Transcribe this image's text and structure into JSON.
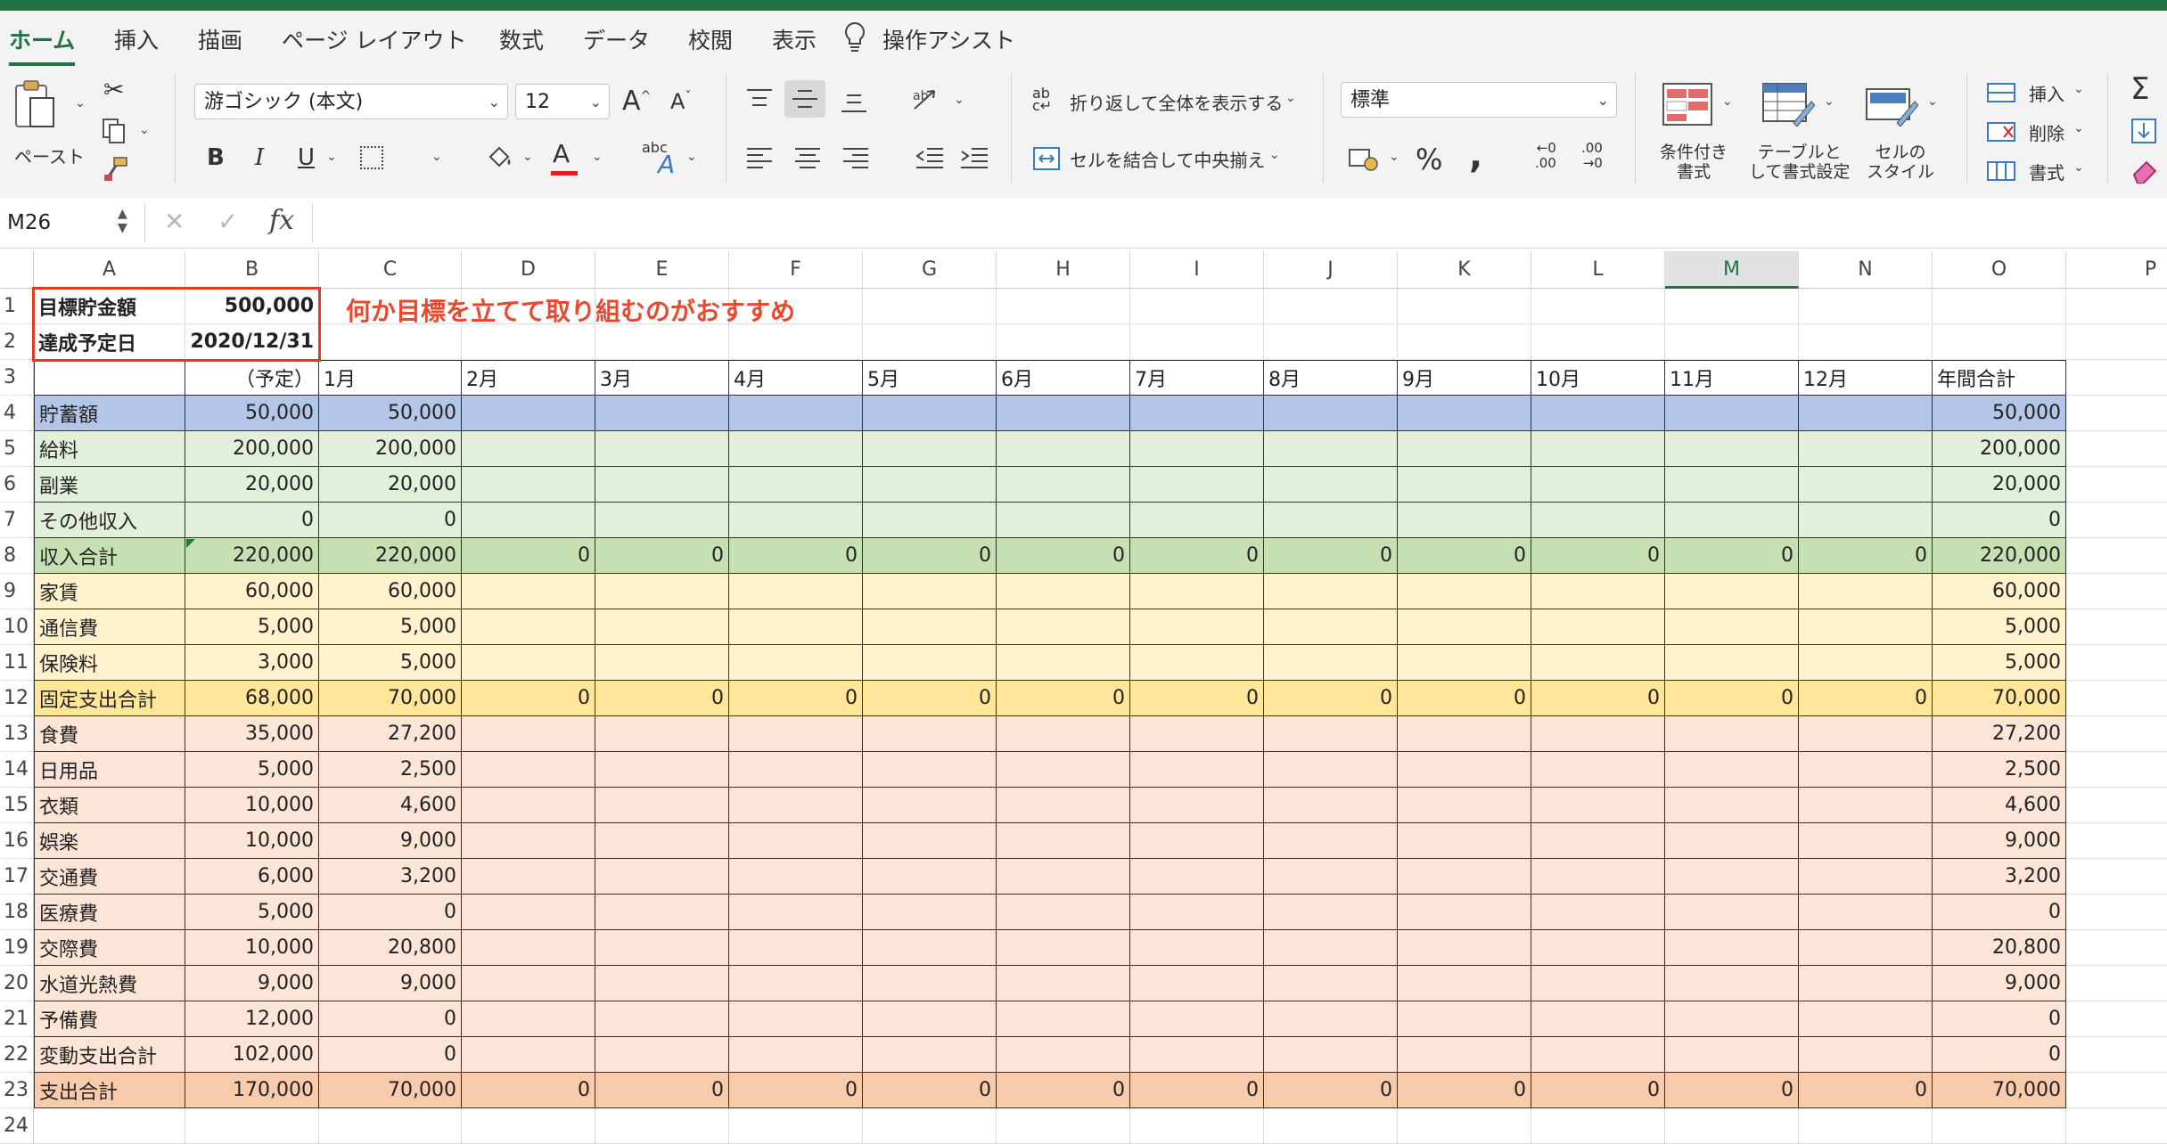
{
  "app": {
    "accent": "#217346"
  },
  "tabs": [
    {
      "label": "ホーム",
      "active": true
    },
    {
      "label": "挿入"
    },
    {
      "label": "描画"
    },
    {
      "label": "ページ レイアウト"
    },
    {
      "label": "数式"
    },
    {
      "label": "データ"
    },
    {
      "label": "校閲"
    },
    {
      "label": "表示"
    },
    {
      "label": "操作アシスト",
      "icon": "lightbulb-icon"
    }
  ],
  "ribbon": {
    "paste_label": "ペースト",
    "font_name": "游ゴシック (本文)",
    "font_size": "12",
    "grow_font": "A",
    "shrink_font": "A",
    "bold": "B",
    "italic": "I",
    "underline": "U",
    "font_color": "A",
    "phonetic_small": "abc",
    "phonetic_large": "A",
    "wrap_small": "ab",
    "wrap_large": "c",
    "wrap_text": "折り返して全体を表示する",
    "merge_center": "セルを結合して中央揃え",
    "number_format": "標準",
    "percent": "%",
    "comma": ",",
    "inc_decimal_top": "←0",
    "inc_decimal_bottom": ".00",
    "dec_decimal_top": ".00",
    "dec_decimal_bottom": "→0",
    "conditional_format": [
      "条件付き",
      "書式"
    ],
    "format_table": [
      "テーブルと",
      "して書式設定"
    ],
    "cell_styles": [
      "セルの",
      "スタイル"
    ],
    "insert": "挿入",
    "delete": "削除",
    "format": "書式"
  },
  "formula_bar": {
    "name_box": "M26",
    "cancel": "✕",
    "enter": "✓",
    "fx": "fx",
    "formula": ""
  },
  "columns": [
    "A",
    "B",
    "C",
    "D",
    "E",
    "F",
    "G",
    "H",
    "I",
    "J",
    "K",
    "L",
    "M",
    "N",
    "O",
    "P"
  ],
  "selected_column": "M",
  "annotation": "何か目標を立てて取り組むのがおすすめ",
  "rows": [
    {
      "n": "1",
      "cells": [
        "目標貯金額",
        "500,000",
        "",
        "",
        "",
        "",
        "",
        "",
        "",
        "",
        "",
        "",
        "",
        "",
        "",
        ""
      ]
    },
    {
      "n": "2",
      "cells": [
        "達成予定日",
        "2020/12/31",
        "",
        "",
        "",
        "",
        "",
        "",
        "",
        "",
        "",
        "",
        "",
        "",
        "",
        ""
      ]
    },
    {
      "n": "3",
      "cells": [
        "",
        "（予定）",
        "1月",
        "2月",
        "3月",
        "4月",
        "5月",
        "6月",
        "7月",
        "8月",
        "9月",
        "10月",
        "11月",
        "12月",
        "年間合計",
        ""
      ]
    },
    {
      "n": "4",
      "cells": [
        "貯蓄額",
        "50,000",
        "50,000",
        "",
        "",
        "",
        "",
        "",
        "",
        "",
        "",
        "",
        "",
        "",
        "50,000",
        ""
      ]
    },
    {
      "n": "5",
      "cells": [
        "給料",
        "200,000",
        "200,000",
        "",
        "",
        "",
        "",
        "",
        "",
        "",
        "",
        "",
        "",
        "",
        "200,000",
        ""
      ]
    },
    {
      "n": "6",
      "cells": [
        "副業",
        "20,000",
        "20,000",
        "",
        "",
        "",
        "",
        "",
        "",
        "",
        "",
        "",
        "",
        "",
        "20,000",
        ""
      ]
    },
    {
      "n": "7",
      "cells": [
        "その他収入",
        "0",
        "0",
        "",
        "",
        "",
        "",
        "",
        "",
        "",
        "",
        "",
        "",
        "",
        "0",
        ""
      ]
    },
    {
      "n": "8",
      "cells": [
        "収入合計",
        "220,000",
        "220,000",
        "0",
        "0",
        "0",
        "0",
        "0",
        "0",
        "0",
        "0",
        "0",
        "0",
        "0",
        "220,000",
        ""
      ]
    },
    {
      "n": "9",
      "cells": [
        "家賃",
        "60,000",
        "60,000",
        "",
        "",
        "",
        "",
        "",
        "",
        "",
        "",
        "",
        "",
        "",
        "60,000",
        ""
      ]
    },
    {
      "n": "10",
      "cells": [
        "通信費",
        "5,000",
        "5,000",
        "",
        "",
        "",
        "",
        "",
        "",
        "",
        "",
        "",
        "",
        "",
        "5,000",
        ""
      ]
    },
    {
      "n": "11",
      "cells": [
        "保険料",
        "3,000",
        "5,000",
        "",
        "",
        "",
        "",
        "",
        "",
        "",
        "",
        "",
        "",
        "",
        "5,000",
        ""
      ]
    },
    {
      "n": "12",
      "cells": [
        "固定支出合計",
        "68,000",
        "70,000",
        "0",
        "0",
        "0",
        "0",
        "0",
        "0",
        "0",
        "0",
        "0",
        "0",
        "0",
        "70,000",
        ""
      ]
    },
    {
      "n": "13",
      "cells": [
        "食費",
        "35,000",
        "27,200",
        "",
        "",
        "",
        "",
        "",
        "",
        "",
        "",
        "",
        "",
        "",
        "27,200",
        ""
      ]
    },
    {
      "n": "14",
      "cells": [
        "日用品",
        "5,000",
        "2,500",
        "",
        "",
        "",
        "",
        "",
        "",
        "",
        "",
        "",
        "",
        "",
        "2,500",
        ""
      ]
    },
    {
      "n": "15",
      "cells": [
        "衣類",
        "10,000",
        "4,600",
        "",
        "",
        "",
        "",
        "",
        "",
        "",
        "",
        "",
        "",
        "",
        "4,600",
        ""
      ]
    },
    {
      "n": "16",
      "cells": [
        "娯楽",
        "10,000",
        "9,000",
        "",
        "",
        "",
        "",
        "",
        "",
        "",
        "",
        "",
        "",
        "",
        "9,000",
        ""
      ]
    },
    {
      "n": "17",
      "cells": [
        "交通費",
        "6,000",
        "3,200",
        "",
        "",
        "",
        "",
        "",
        "",
        "",
        "",
        "",
        "",
        "",
        "3,200",
        ""
      ]
    },
    {
      "n": "18",
      "cells": [
        "医療費",
        "5,000",
        "0",
        "",
        "",
        "",
        "",
        "",
        "",
        "",
        "",
        "",
        "",
        "",
        "0",
        ""
      ]
    },
    {
      "n": "19",
      "cells": [
        "交際費",
        "10,000",
        "20,800",
        "",
        "",
        "",
        "",
        "",
        "",
        "",
        "",
        "",
        "",
        "",
        "20,800",
        ""
      ]
    },
    {
      "n": "20",
      "cells": [
        "水道光熱費",
        "9,000",
        "9,000",
        "",
        "",
        "",
        "",
        "",
        "",
        "",
        "",
        "",
        "",
        "",
        "9,000",
        ""
      ]
    },
    {
      "n": "21",
      "cells": [
        "予備費",
        "12,000",
        "0",
        "",
        "",
        "",
        "",
        "",
        "",
        "",
        "",
        "",
        "",
        "",
        "0",
        ""
      ]
    },
    {
      "n": "22",
      "cells": [
        "変動支出合計",
        "102,000",
        "0",
        "",
        "",
        "",
        "",
        "",
        "",
        "",
        "",
        "",
        "",
        "",
        "0",
        ""
      ]
    },
    {
      "n": "23",
      "cells": [
        "支出合計",
        "170,000",
        "70,000",
        "0",
        "0",
        "0",
        "0",
        "0",
        "0",
        "0",
        "0",
        "0",
        "0",
        "0",
        "70,000",
        ""
      ]
    },
    {
      "n": "24",
      "cells": [
        "",
        "",
        "",
        "",
        "",
        "",
        "",
        "",
        "",
        "",
        "",
        "",
        "",
        "",
        "",
        ""
      ]
    }
  ],
  "row_colors": {
    "4": "#b4c6e7",
    "5": "#e2efda",
    "6": "#e2efda",
    "7": "#e2efda",
    "8": "#c6e0b4",
    "9": "#fff2cc",
    "10": "#fff2cc",
    "11": "#fff2cc",
    "12": "#ffe699",
    "13": "#fce4d6",
    "14": "#fce4d6",
    "15": "#fce4d6",
    "16": "#fce4d6",
    "17": "#fce4d6",
    "18": "#fce4d6",
    "19": "#fce4d6",
    "20": "#fce4d6",
    "21": "#fce4d6",
    "22": "#fce4d6",
    "23": "#f8cbad"
  }
}
